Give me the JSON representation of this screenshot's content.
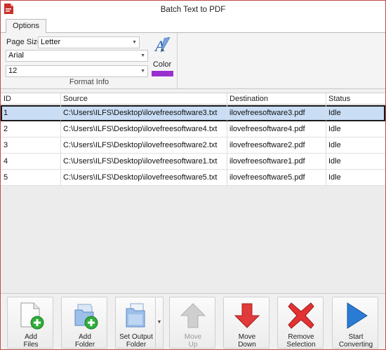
{
  "window": {
    "title": "Batch Text to PDF"
  },
  "ribbon": {
    "tab": "Options",
    "page_size_label": "Page Size",
    "page_size": "Letter",
    "font": "Arial",
    "font_size": "12",
    "color_label": "Color",
    "color_value": "#9a2fd0",
    "group_label": "Format Info"
  },
  "table": {
    "headers": [
      "ID",
      "Source",
      "Destination",
      "Status"
    ],
    "rows": [
      {
        "id": "1",
        "source": "C:\\Users\\ILFS\\Desktop\\ilovefreesoftware3.txt",
        "destination": "ilovefreesoftware3.pdf",
        "status": "Idle",
        "selected": true
      },
      {
        "id": "2",
        "source": "C:\\Users\\ILFS\\Desktop\\ilovefreesoftware4.txt",
        "destination": "ilovefreesoftware4.pdf",
        "status": "Idle"
      },
      {
        "id": "3",
        "source": "C:\\Users\\ILFS\\Desktop\\ilovefreesoftware2.txt",
        "destination": "ilovefreesoftware2.pdf",
        "status": "Idle"
      },
      {
        "id": "4",
        "source": "C:\\Users\\ILFS\\Desktop\\ilovefreesoftware1.txt",
        "destination": "ilovefreesoftware1.pdf",
        "status": "Idle"
      },
      {
        "id": "5",
        "source": "C:\\Users\\ILFS\\Desktop\\ilovefreesoftware5.txt",
        "destination": "ilovefreesoftware5.pdf",
        "status": "Idle"
      }
    ]
  },
  "toolbar": {
    "add_files": {
      "line1": "Add",
      "line2": "Files",
      "icon": "add-file-icon"
    },
    "add_folder": {
      "line1": "Add",
      "line2": "Folder",
      "icon": "add-folder-icon"
    },
    "set_output": {
      "line1": "Set Output",
      "line2": "Folder",
      "icon": "output-folder-icon"
    },
    "move_up": {
      "line1": "Move",
      "line2": "Up",
      "icon": "arrow-up-icon",
      "disabled": true
    },
    "move_down": {
      "line1": "Move",
      "line2": "Down",
      "icon": "arrow-down-icon"
    },
    "remove": {
      "line1": "Remove",
      "line2": "Selection",
      "icon": "remove-x-icon"
    },
    "start": {
      "line1": "Start",
      "line2": "Converting",
      "icon": "play-icon"
    }
  },
  "colors": {
    "accent_purple": "#9a2fd0",
    "down_red": "#e03a3a",
    "start_blue": "#2a7bd4",
    "add_green": "#2fae3a"
  }
}
